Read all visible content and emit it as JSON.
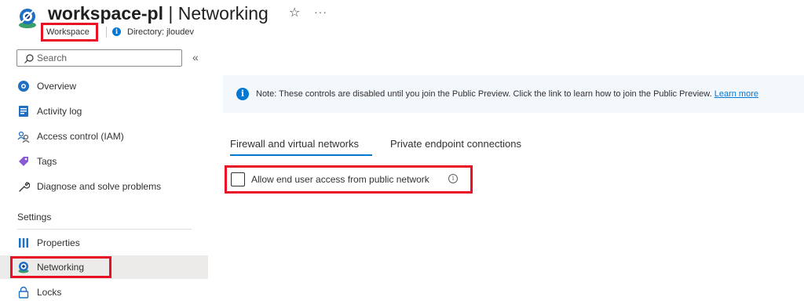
{
  "header": {
    "resource_name": "workspace-pl",
    "separator": "|",
    "page": "Networking",
    "favorite_icon": "star-icon",
    "more_label": "···",
    "resource_type": "Workspace",
    "info_glyph": "i",
    "directory": "Directory: jloudev"
  },
  "search": {
    "placeholder": "Search",
    "collapse_label": "«"
  },
  "sidebar": {
    "items": [
      {
        "label": "Overview",
        "icon": "overview-icon"
      },
      {
        "label": "Activity log",
        "icon": "activity-log-icon"
      },
      {
        "label": "Access control (IAM)",
        "icon": "iam-icon"
      },
      {
        "label": "Tags",
        "icon": "tag-icon"
      },
      {
        "label": "Diagnose and solve problems",
        "icon": "wrench-icon"
      }
    ],
    "settings_title": "Settings",
    "settings_items": [
      {
        "label": "Properties",
        "icon": "properties-icon"
      },
      {
        "label": "Networking",
        "icon": "networking-icon",
        "active": true
      },
      {
        "label": "Locks",
        "icon": "lock-icon"
      }
    ]
  },
  "banner": {
    "info_glyph": "i",
    "text": "Note: These controls are disabled until you join the Public Preview. Click the link to learn how to join the Public Preview.",
    "link": "Learn more"
  },
  "tabs": [
    {
      "label": "Firewall and virtual networks",
      "selected": true
    },
    {
      "label": "Private endpoint connections",
      "selected": false
    }
  ],
  "option": {
    "label": "Allow end user access from public network",
    "checked": false,
    "info_glyph": "i"
  },
  "colors": {
    "accent": "#0078d4",
    "highlight_box": "#e81123",
    "active_nav_bg": "#edebe9",
    "banner_bg": "#f3f8fd"
  }
}
